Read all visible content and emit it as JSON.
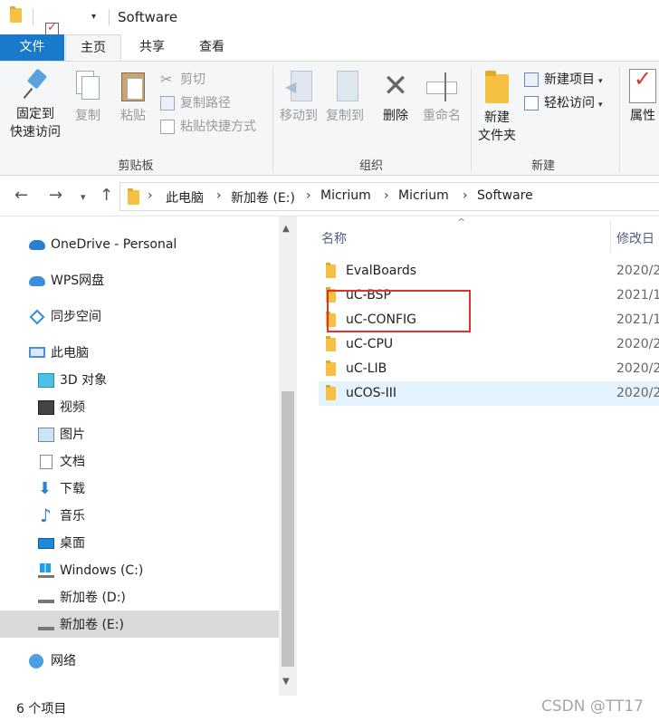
{
  "window": {
    "title": "Software"
  },
  "tabs": {
    "file": "文件",
    "home": "主页",
    "share": "共享",
    "view": "查看"
  },
  "ribbon": {
    "clipboard": {
      "label": "剪贴板",
      "pin_line1": "固定到",
      "pin_line2": "快速访问",
      "copy": "复制",
      "paste": "粘贴",
      "cut": "剪切",
      "copy_path": "复制路径",
      "paste_shortcut": "粘贴快捷方式"
    },
    "organize": {
      "label": "组织",
      "move_to": "移动到",
      "copy_to": "复制到",
      "delete": "删除",
      "rename": "重命名"
    },
    "new": {
      "label": "新建",
      "new_item": "新建项目",
      "easy_access": "轻松访问",
      "new_folder_line1": "新建",
      "new_folder_line2": "文件夹"
    },
    "open": {
      "properties": "属性"
    }
  },
  "address": {
    "breadcrumbs": [
      "此电脑",
      "新加卷 (E:)",
      "Micrium",
      "Micrium",
      "Software"
    ],
    "separator": "›"
  },
  "sidebar": {
    "items": [
      {
        "label": "OneDrive - Personal",
        "icon": "onedrive-icon"
      },
      {
        "label": "WPS网盘",
        "icon": "wps-cloud-icon"
      },
      {
        "label": "同步空间",
        "icon": "sync-space-icon"
      },
      {
        "label": "此电脑",
        "icon": "this-pc-icon"
      },
      {
        "label": "3D 对象",
        "icon": "3d-objects-icon"
      },
      {
        "label": "视频",
        "icon": "video-icon"
      },
      {
        "label": "图片",
        "icon": "pictures-icon"
      },
      {
        "label": "文档",
        "icon": "documents-icon"
      },
      {
        "label": "下载",
        "icon": "downloads-icon"
      },
      {
        "label": "音乐",
        "icon": "music-icon"
      },
      {
        "label": "桌面",
        "icon": "desktop-icon"
      },
      {
        "label": "Windows (C:)",
        "icon": "windows-drive-icon"
      },
      {
        "label": "新加卷 (D:)",
        "icon": "drive-icon"
      },
      {
        "label": "新加卷 (E:)",
        "icon": "drive-icon",
        "selected": true
      },
      {
        "label": "网络",
        "icon": "network-icon"
      }
    ]
  },
  "filelist": {
    "columns": {
      "name": "名称",
      "modified": "修改日"
    },
    "rows": [
      {
        "name": "EvalBoards",
        "date": "2020/2"
      },
      {
        "name": "uC-BSP",
        "date": "2021/1"
      },
      {
        "name": "uC-CONFIG",
        "date": "2021/1"
      },
      {
        "name": "uC-CPU",
        "date": "2020/2"
      },
      {
        "name": "uC-LIB",
        "date": "2020/2"
      },
      {
        "name": "uCOS-III",
        "date": "2020/2",
        "selected": true
      }
    ]
  },
  "status": {
    "item_count": "6 个项目"
  },
  "watermark": "CSDN @TT17"
}
